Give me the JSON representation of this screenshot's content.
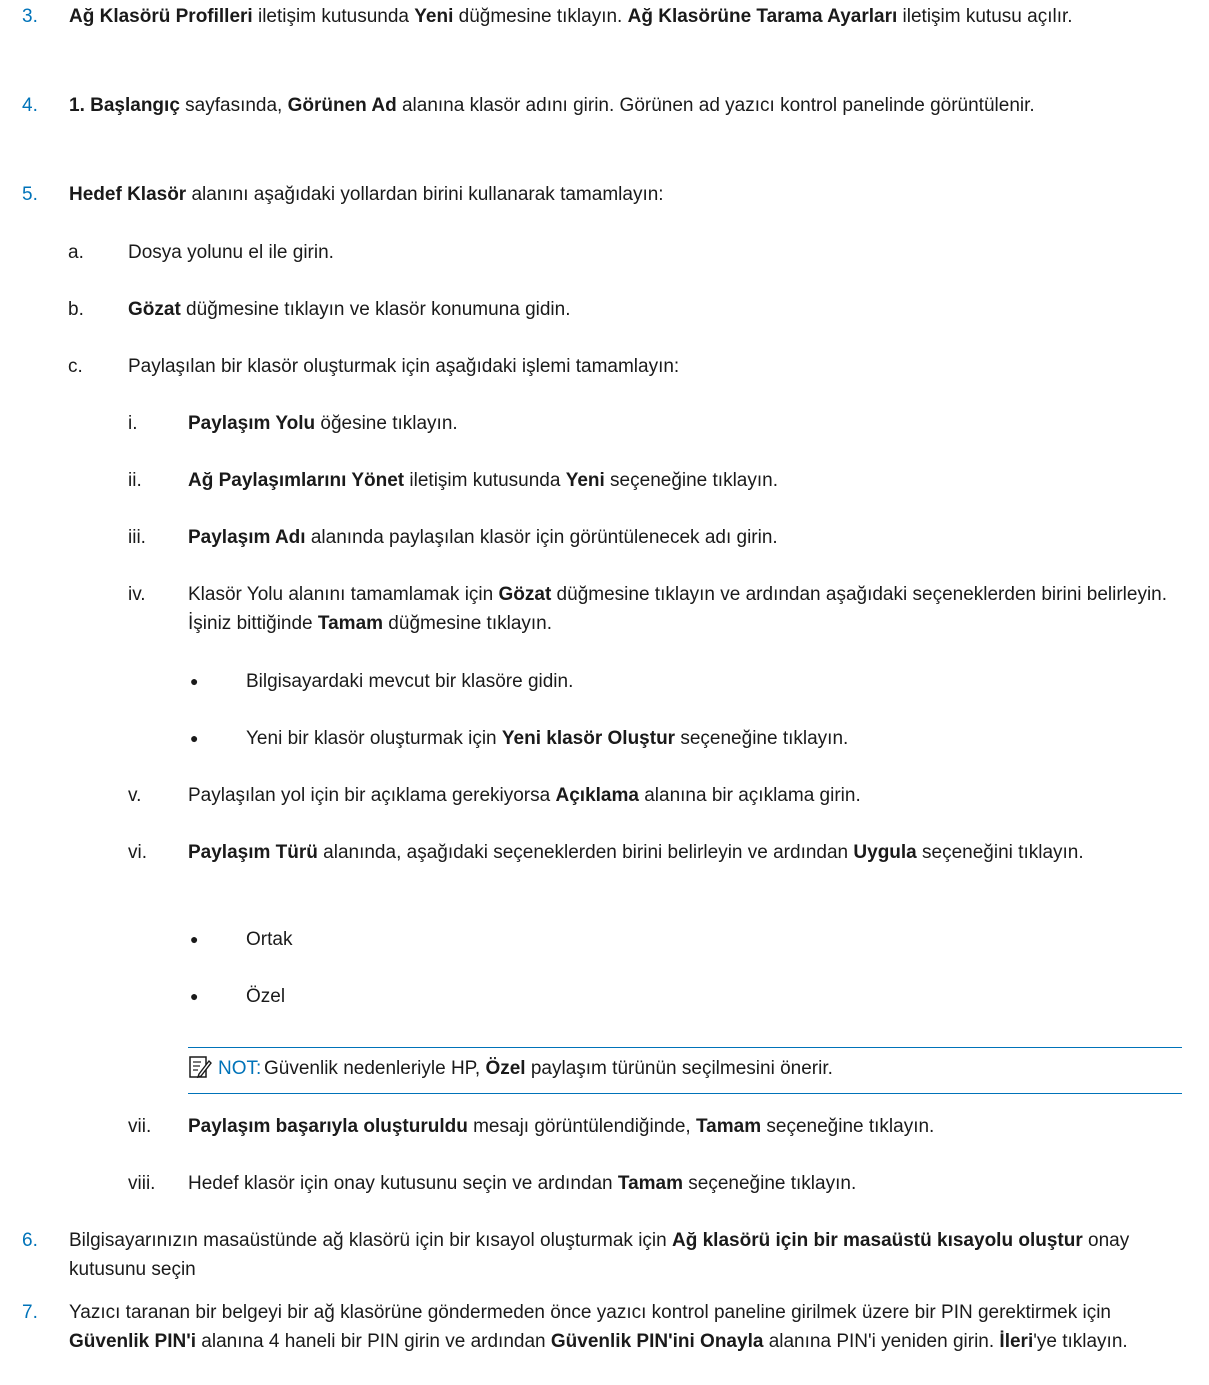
{
  "steps": {
    "s3": {
      "num": "3.",
      "b1": "Ağ Klasörü Profilleri",
      "t1": " iletişim kutusunda ",
      "b2": "Yeni",
      "t2": " düğmesine tıklayın. ",
      "b3": "Ağ Klasörüne Tarama Ayarları",
      "t3": " iletişim kutusu açılır."
    },
    "s4": {
      "num": "4.",
      "b1": "1. Başlangıç",
      "t1": " sayfasında, ",
      "b2": "Görünen Ad",
      "t2": " alanına klasör adını girin. Görünen ad yazıcı kontrol panelinde görüntülenir."
    },
    "s5": {
      "num": "5.",
      "b1": "Hedef Klasör",
      "t1": " alanını aşağıdaki yollardan birini kullanarak tamamlayın:"
    },
    "a": {
      "num": "a.",
      "t1": "Dosya yolunu el ile girin."
    },
    "b": {
      "num": "b.",
      "b1": "Gözat",
      "t1": " düğmesine tıklayın ve klasör konumuna gidin."
    },
    "c": {
      "num": "c.",
      "t1": "Paylaşılan bir klasör oluşturmak için aşağıdaki işlemi tamamlayın:"
    },
    "i": {
      "num": "i.",
      "b1": "Paylaşım Yolu",
      "t1": " öğesine tıklayın."
    },
    "ii": {
      "num": "ii.",
      "b1": "Ağ Paylaşımlarını Yönet",
      "t1": " iletişim kutusunda ",
      "b2": "Yeni",
      "t2": " seçeneğine tıklayın."
    },
    "iii": {
      "num": "iii.",
      "b1": "Paylaşım Adı",
      "t1": " alanında paylaşılan klasör için görüntülenecek adı girin."
    },
    "iv": {
      "num": "iv.",
      "t0": "Klasör Yolu alanını tamamlamak için ",
      "b1": "Gözat",
      "t1": " düğmesine tıklayın ve ardından aşağıdaki seçeneklerden birini belirleyin. İşiniz bittiğinde ",
      "b2": "Tamam",
      "t2": " düğmesine tıklayın."
    },
    "iv_b1": {
      "bullet": "●",
      "t1": "Bilgisayardaki mevcut bir klasöre gidin."
    },
    "iv_b2": {
      "bullet": "●",
      "t0": "Yeni bir klasör oluşturmak için ",
      "b1": "Yeni klasör Oluştur",
      "t1": " seçeneğine tıklayın."
    },
    "v": {
      "num": "v.",
      "t0": "Paylaşılan yol için bir açıklama gerekiyorsa ",
      "b1": "Açıklama",
      "t1": " alanına bir açıklama girin."
    },
    "vi": {
      "num": "vi.",
      "b1": "Paylaşım Türü",
      "t1": " alanında, aşağıdaki seçeneklerden birini belirleyin ve ardından ",
      "b2": "Uygula",
      "t2": " seçeneğini tıklayın."
    },
    "vi_b1": {
      "bullet": "●",
      "t1": "Ortak"
    },
    "vi_b2": {
      "bullet": "●",
      "t1": "Özel"
    },
    "note": {
      "label": "NOT:",
      "t0": "Güvenlik nedenleriyle HP, ",
      "b1": "Özel",
      "t1": " paylaşım türünün seçilmesini önerir."
    },
    "vii": {
      "num": "vii.",
      "b1": "Paylaşım başarıyla oluşturuldu",
      "t1": " mesajı görüntülendiğinde, ",
      "b2": "Tamam",
      "t2": " seçeneğine tıklayın."
    },
    "viii": {
      "num": "viii.",
      "t0": "Hedef klasör için onay kutusunu seçin ve ardından ",
      "b1": "Tamam",
      "t1": " seçeneğine tıklayın."
    },
    "s6": {
      "num": "6.",
      "t0": "Bilgisayarınızın masaüstünde ağ klasörü için bir kısayol oluşturmak için ",
      "b1": "Ağ klasörü için bir masaüstü kısayolu oluştur",
      "t1": " onay kutusunu seçin"
    },
    "s7": {
      "num": "7.",
      "t0": "Yazıcı taranan bir belgeyi bir ağ klasörüne göndermeden önce yazıcı kontrol paneline girilmek üzere bir PIN gerektirmek için ",
      "b1": "Güvenlik PIN'i",
      "t1": " alanına 4 haneli bir PIN girin ve ardından ",
      "b2": "Güvenlik PIN'ini Onayla",
      "t2": " alanına PIN'i yeniden girin. ",
      "b3": "İleri",
      "t3": "'ye tıklayın."
    }
  },
  "colors": {
    "accent": "#0073b9",
    "text": "#1a1a1a"
  },
  "icons": {
    "note": "note-pencil-icon"
  }
}
